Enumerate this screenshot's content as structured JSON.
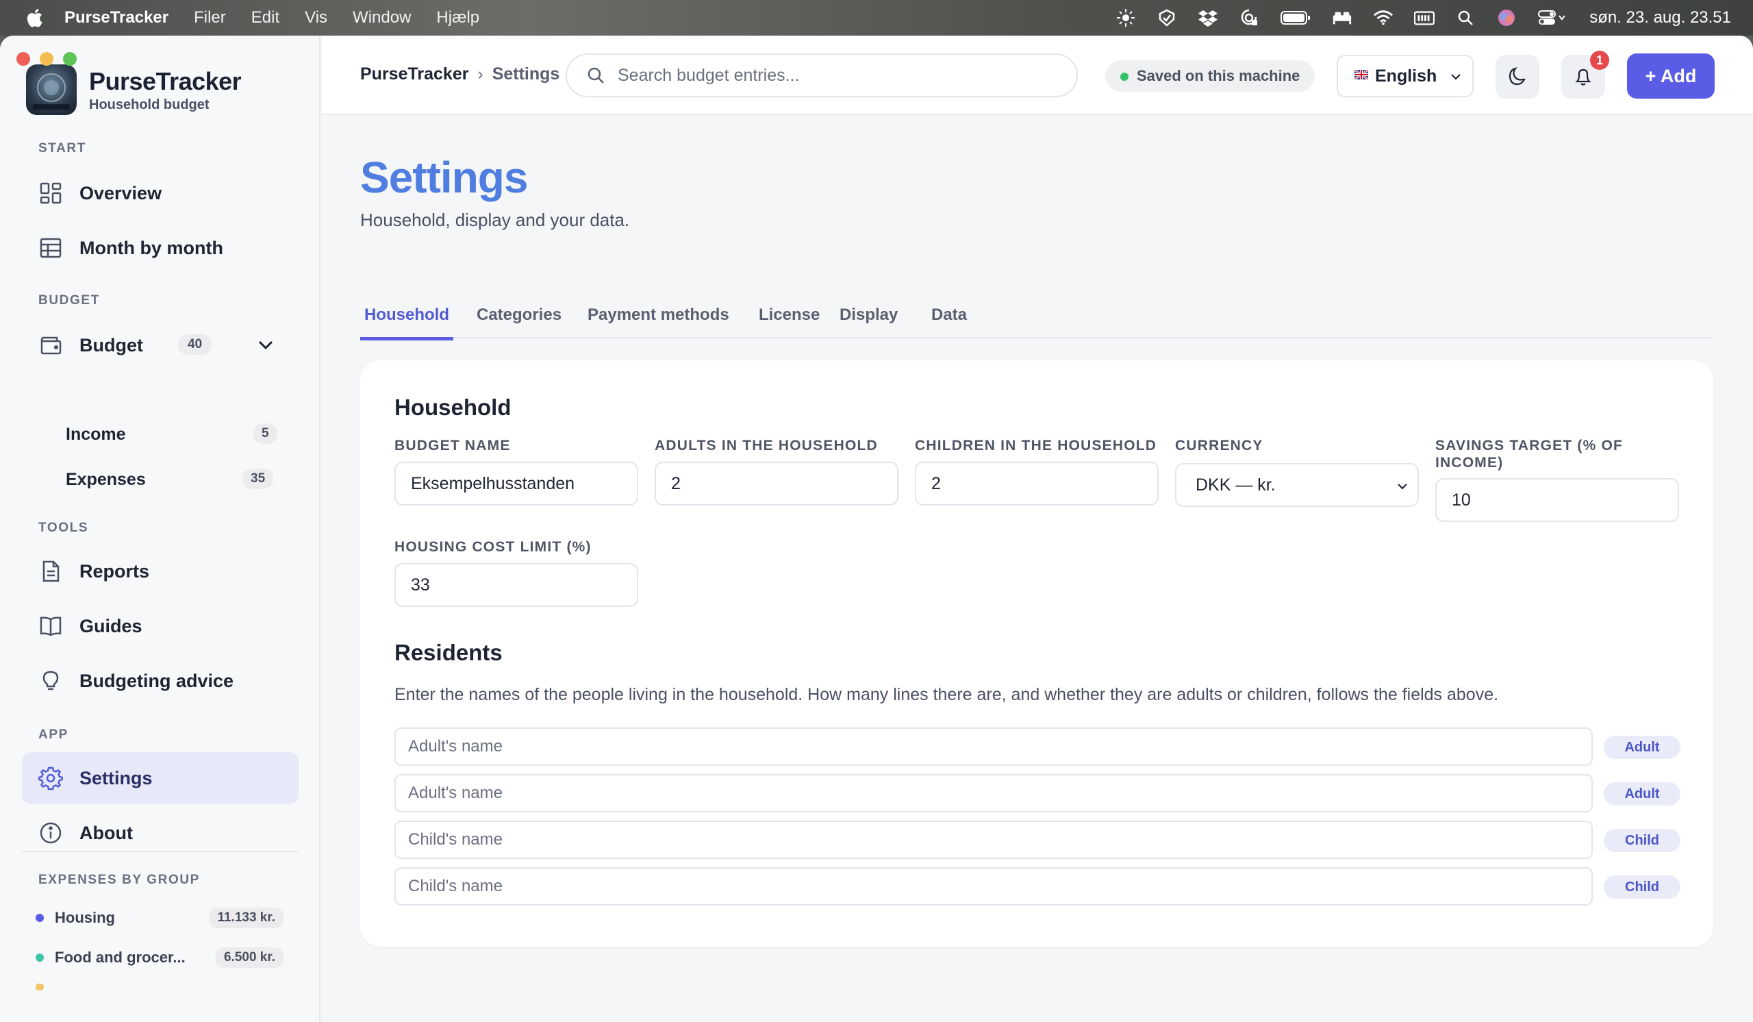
{
  "menubar": {
    "app_name": "PurseTracker",
    "menus": [
      "Filer",
      "Edit",
      "Vis",
      "Window",
      "Hjælp"
    ],
    "clock": "søn. 23. aug.  23.51",
    "status_icons": [
      "brightness-icon",
      "vpn-icon",
      "dropbox-icon",
      "privacy-icon",
      "battery-icon",
      "bed-icon",
      "wifi-icon",
      "keyboard-icon",
      "spotlight-icon",
      "siri-icon",
      "control-center-icon"
    ]
  },
  "sidebar": {
    "brand_title": "PurseTracker",
    "brand_subtitle": "Household budget",
    "sections": {
      "start": "START",
      "budget": "BUDGET",
      "tools": "TOOLS",
      "app": "APP",
      "expenses_by_group": "EXPENSES BY GROUP"
    },
    "items": {
      "overview": "Overview",
      "month_by_month": "Month by month",
      "budget": "Budget",
      "budget_count": "40",
      "income": "Income",
      "income_count": "5",
      "expenses": "Expenses",
      "expenses_count": "35",
      "reports": "Reports",
      "guides": "Guides",
      "budgeting_advice": "Budgeting advice",
      "settings": "Settings",
      "about": "About"
    },
    "groups": [
      {
        "name": "Housing",
        "amount": "11.133 kr.",
        "color": "#5b5ce6"
      },
      {
        "name": "Food and grocer...",
        "amount": "6.500 kr.",
        "color": "#3ec6a8"
      }
    ]
  },
  "topbar": {
    "breadcrumb_root": "PurseTracker",
    "breadcrumb_sep": "›",
    "breadcrumb_current": "Settings",
    "search_placeholder": "Search budget entries...",
    "saved_status": "Saved on this machine",
    "language": "English",
    "notification_count": "1",
    "add_label": "+ Add"
  },
  "main": {
    "title": "Settings",
    "subtitle": "Household, display and your data.",
    "tabs": [
      "Household",
      "Categories",
      "Payment methods",
      "License",
      "Display",
      "Data"
    ],
    "active_tab": "Household"
  },
  "household": {
    "heading": "Household",
    "budget_name_label": "BUDGET NAME",
    "budget_name_value": "Eksempelhusstanden",
    "adults_label": "ADULTS IN THE HOUSEHOLD",
    "adults_value": "2",
    "children_label": "CHILDREN IN THE HOUSEHOLD",
    "children_value": "2",
    "currency_label": "CURRENCY",
    "currency_value": "DKK — kr.",
    "savings_label_line1": "SAVINGS TARGET (% OF",
    "savings_label_line2": "INCOME)",
    "savings_value": "10",
    "housing_label": "HOUSING COST LIMIT (%)",
    "housing_value": "33"
  },
  "residents": {
    "heading": "Residents",
    "description": "Enter the names of the people living in the household. How many lines there are, and whether they are adults or children, follows the fields above.",
    "rows": [
      {
        "placeholder": "Adult's name",
        "role": "Adult"
      },
      {
        "placeholder": "Adult's name",
        "role": "Adult"
      },
      {
        "placeholder": "Child's name",
        "role": "Child"
      },
      {
        "placeholder": "Child's name",
        "role": "Child"
      }
    ]
  },
  "colors": {
    "accent": "#5b5ce6",
    "title_blue": "#4f7ee0",
    "saved_green": "#34c16a",
    "badge_red": "#e5484d"
  }
}
